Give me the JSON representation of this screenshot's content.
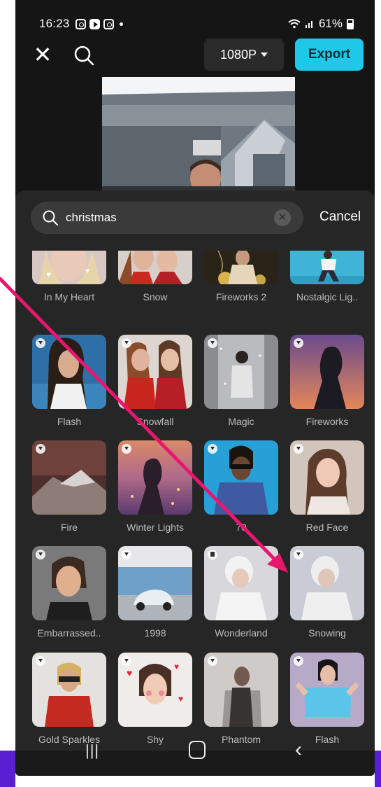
{
  "status": {
    "time": "16:23",
    "battery": "61%"
  },
  "toolbar": {
    "resolution": "1080P",
    "export_label": "Export"
  },
  "search": {
    "query": "christmas",
    "cancel_label": "Cancel"
  },
  "effects": [
    {
      "label": "In My Heart",
      "badge": "none"
    },
    {
      "label": "Snow",
      "badge": "none"
    },
    {
      "label": "Fireworks 2",
      "badge": "none"
    },
    {
      "label": "Nostalgic Lig..",
      "badge": "none"
    },
    {
      "label": "Flash",
      "badge": "download"
    },
    {
      "label": "Snowfall",
      "badge": "download"
    },
    {
      "label": "Magic",
      "badge": "download"
    },
    {
      "label": "Fireworks",
      "badge": "download"
    },
    {
      "label": "Fire",
      "badge": "download"
    },
    {
      "label": "Winter Lights",
      "badge": "download"
    },
    {
      "label": "70",
      "badge": "download"
    },
    {
      "label": "Red Face",
      "badge": "download"
    },
    {
      "label": "Embarrassed..",
      "badge": "download"
    },
    {
      "label": "1998",
      "badge": "download"
    },
    {
      "label": "Wonderland",
      "badge": "bookmark"
    },
    {
      "label": "Snowing",
      "badge": "download"
    },
    {
      "label": "Gold Sparkles",
      "badge": "download"
    },
    {
      "label": "Shy",
      "badge": "download"
    },
    {
      "label": "Phantom",
      "badge": "download"
    },
    {
      "label": "Flash",
      "badge": "download"
    }
  ],
  "colors": {
    "accent": "#1fc8e8",
    "annotation_arrow": "#e8176e",
    "sheet": "#262626"
  }
}
